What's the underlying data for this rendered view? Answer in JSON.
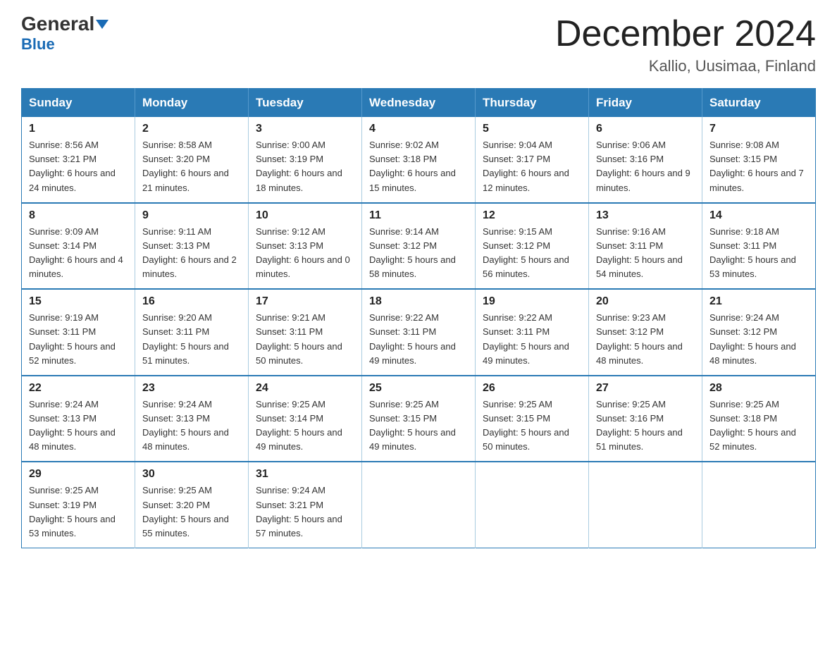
{
  "logo": {
    "general": "General",
    "blue": "Blue"
  },
  "header": {
    "title": "December 2024",
    "location": "Kallio, Uusimaa, Finland"
  },
  "days_of_week": [
    "Sunday",
    "Monday",
    "Tuesday",
    "Wednesday",
    "Thursday",
    "Friday",
    "Saturday"
  ],
  "weeks": [
    [
      {
        "day": "1",
        "sunrise": "8:56 AM",
        "sunset": "3:21 PM",
        "daylight": "6 hours and 24 minutes."
      },
      {
        "day": "2",
        "sunrise": "8:58 AM",
        "sunset": "3:20 PM",
        "daylight": "6 hours and 21 minutes."
      },
      {
        "day": "3",
        "sunrise": "9:00 AM",
        "sunset": "3:19 PM",
        "daylight": "6 hours and 18 minutes."
      },
      {
        "day": "4",
        "sunrise": "9:02 AM",
        "sunset": "3:18 PM",
        "daylight": "6 hours and 15 minutes."
      },
      {
        "day": "5",
        "sunrise": "9:04 AM",
        "sunset": "3:17 PM",
        "daylight": "6 hours and 12 minutes."
      },
      {
        "day": "6",
        "sunrise": "9:06 AM",
        "sunset": "3:16 PM",
        "daylight": "6 hours and 9 minutes."
      },
      {
        "day": "7",
        "sunrise": "9:08 AM",
        "sunset": "3:15 PM",
        "daylight": "6 hours and 7 minutes."
      }
    ],
    [
      {
        "day": "8",
        "sunrise": "9:09 AM",
        "sunset": "3:14 PM",
        "daylight": "6 hours and 4 minutes."
      },
      {
        "day": "9",
        "sunrise": "9:11 AM",
        "sunset": "3:13 PM",
        "daylight": "6 hours and 2 minutes."
      },
      {
        "day": "10",
        "sunrise": "9:12 AM",
        "sunset": "3:13 PM",
        "daylight": "6 hours and 0 minutes."
      },
      {
        "day": "11",
        "sunrise": "9:14 AM",
        "sunset": "3:12 PM",
        "daylight": "5 hours and 58 minutes."
      },
      {
        "day": "12",
        "sunrise": "9:15 AM",
        "sunset": "3:12 PM",
        "daylight": "5 hours and 56 minutes."
      },
      {
        "day": "13",
        "sunrise": "9:16 AM",
        "sunset": "3:11 PM",
        "daylight": "5 hours and 54 minutes."
      },
      {
        "day": "14",
        "sunrise": "9:18 AM",
        "sunset": "3:11 PM",
        "daylight": "5 hours and 53 minutes."
      }
    ],
    [
      {
        "day": "15",
        "sunrise": "9:19 AM",
        "sunset": "3:11 PM",
        "daylight": "5 hours and 52 minutes."
      },
      {
        "day": "16",
        "sunrise": "9:20 AM",
        "sunset": "3:11 PM",
        "daylight": "5 hours and 51 minutes."
      },
      {
        "day": "17",
        "sunrise": "9:21 AM",
        "sunset": "3:11 PM",
        "daylight": "5 hours and 50 minutes."
      },
      {
        "day": "18",
        "sunrise": "9:22 AM",
        "sunset": "3:11 PM",
        "daylight": "5 hours and 49 minutes."
      },
      {
        "day": "19",
        "sunrise": "9:22 AM",
        "sunset": "3:11 PM",
        "daylight": "5 hours and 49 minutes."
      },
      {
        "day": "20",
        "sunrise": "9:23 AM",
        "sunset": "3:12 PM",
        "daylight": "5 hours and 48 minutes."
      },
      {
        "day": "21",
        "sunrise": "9:24 AM",
        "sunset": "3:12 PM",
        "daylight": "5 hours and 48 minutes."
      }
    ],
    [
      {
        "day": "22",
        "sunrise": "9:24 AM",
        "sunset": "3:13 PM",
        "daylight": "5 hours and 48 minutes."
      },
      {
        "day": "23",
        "sunrise": "9:24 AM",
        "sunset": "3:13 PM",
        "daylight": "5 hours and 48 minutes."
      },
      {
        "day": "24",
        "sunrise": "9:25 AM",
        "sunset": "3:14 PM",
        "daylight": "5 hours and 49 minutes."
      },
      {
        "day": "25",
        "sunrise": "9:25 AM",
        "sunset": "3:15 PM",
        "daylight": "5 hours and 49 minutes."
      },
      {
        "day": "26",
        "sunrise": "9:25 AM",
        "sunset": "3:15 PM",
        "daylight": "5 hours and 50 minutes."
      },
      {
        "day": "27",
        "sunrise": "9:25 AM",
        "sunset": "3:16 PM",
        "daylight": "5 hours and 51 minutes."
      },
      {
        "day": "28",
        "sunrise": "9:25 AM",
        "sunset": "3:18 PM",
        "daylight": "5 hours and 52 minutes."
      }
    ],
    [
      {
        "day": "29",
        "sunrise": "9:25 AM",
        "sunset": "3:19 PM",
        "daylight": "5 hours and 53 minutes."
      },
      {
        "day": "30",
        "sunrise": "9:25 AM",
        "sunset": "3:20 PM",
        "daylight": "5 hours and 55 minutes."
      },
      {
        "day": "31",
        "sunrise": "9:24 AM",
        "sunset": "3:21 PM",
        "daylight": "5 hours and 57 minutes."
      },
      null,
      null,
      null,
      null
    ]
  ]
}
